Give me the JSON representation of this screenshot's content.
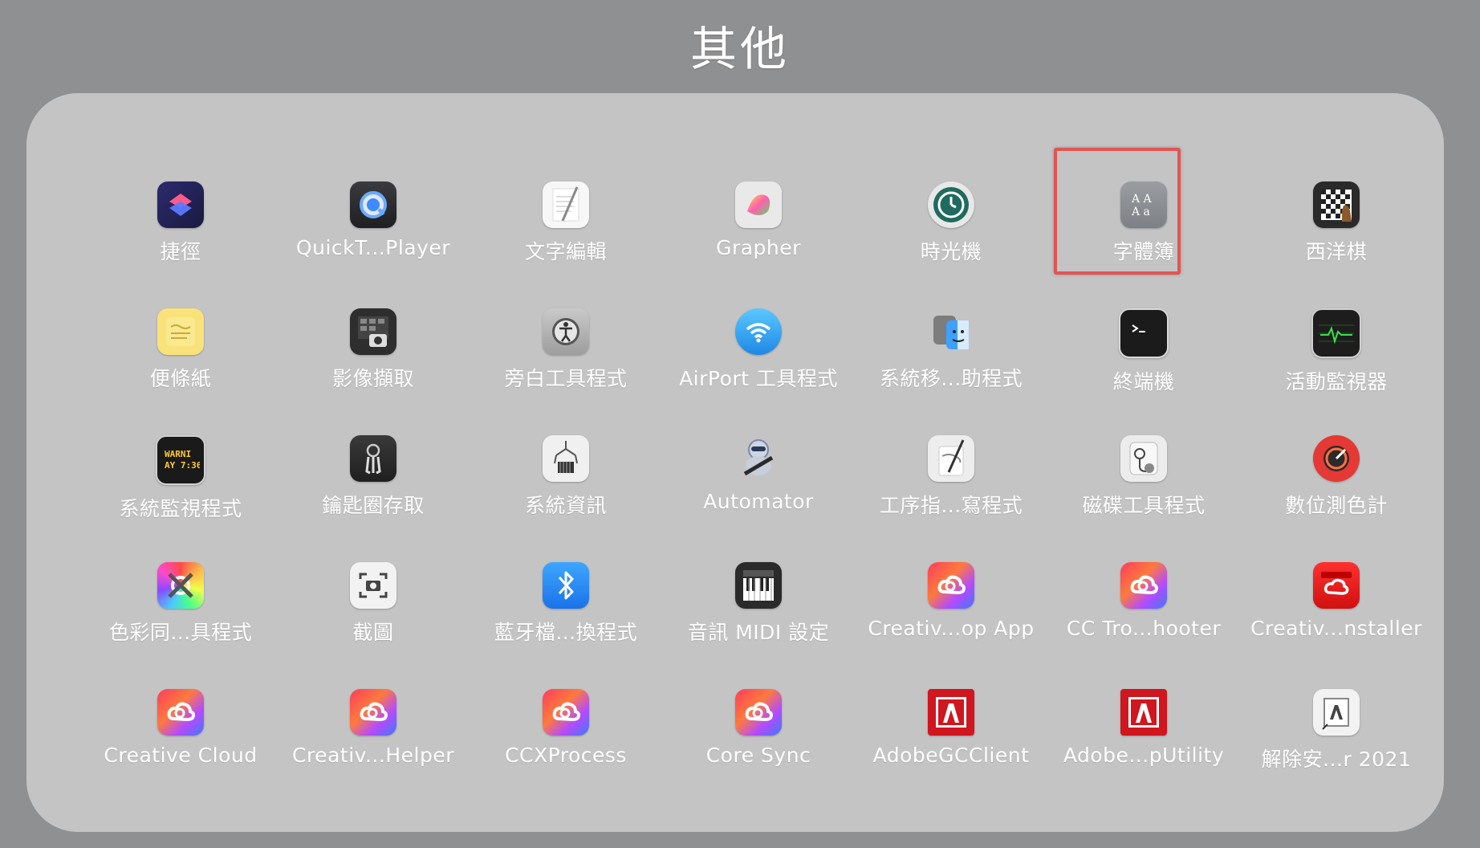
{
  "folder": {
    "title": "其他"
  },
  "highlight": {
    "app_index": 5,
    "color": "#e25552"
  },
  "apps": [
    {
      "label": "捷徑",
      "icon": "shortcuts-icon"
    },
    {
      "label": "QuickT...Player",
      "icon": "quicktime-icon"
    },
    {
      "label": "文字編輯",
      "icon": "textedit-icon"
    },
    {
      "label": "Grapher",
      "icon": "grapher-icon"
    },
    {
      "label": "時光機",
      "icon": "time-machine-icon"
    },
    {
      "label": "字體簿",
      "icon": "font-book-icon"
    },
    {
      "label": "西洋棋",
      "icon": "chess-icon"
    },
    {
      "label": "便條紙",
      "icon": "stickies-icon"
    },
    {
      "label": "影像擷取",
      "icon": "image-capture-icon"
    },
    {
      "label": "旁白工具程式",
      "icon": "voiceover-utility-icon"
    },
    {
      "label": "AirPort 工具程式",
      "icon": "airport-utility-icon"
    },
    {
      "label": "系統移...助程式",
      "icon": "migration-assistant-icon"
    },
    {
      "label": "終端機",
      "icon": "terminal-icon"
    },
    {
      "label": "活動監視器",
      "icon": "activity-monitor-icon"
    },
    {
      "label": "系統監視程式",
      "icon": "console-icon"
    },
    {
      "label": "鑰匙圈存取",
      "icon": "keychain-access-icon"
    },
    {
      "label": "系統資訊",
      "icon": "system-information-icon"
    },
    {
      "label": "Automator",
      "icon": "automator-icon"
    },
    {
      "label": "工序指...寫程式",
      "icon": "script-editor-icon"
    },
    {
      "label": "磁碟工具程式",
      "icon": "disk-utility-icon"
    },
    {
      "label": "數位測色計",
      "icon": "digital-color-meter-icon"
    },
    {
      "label": "色彩同...具程式",
      "icon": "colorsync-utility-icon"
    },
    {
      "label": "截圖",
      "icon": "screenshot-icon"
    },
    {
      "label": "藍牙檔...換程式",
      "icon": "bluetooth-file-exchange-icon"
    },
    {
      "label": "音訊 MIDI 設定",
      "icon": "audio-midi-setup-icon"
    },
    {
      "label": "Creativ...op App",
      "icon": "creative-cloud-desktop-icon"
    },
    {
      "label": "CC Tro...hooter",
      "icon": "cc-troubleshooter-icon"
    },
    {
      "label": "Creativ...nstaller",
      "icon": "creative-cloud-installer-icon"
    },
    {
      "label": "Creative Cloud",
      "icon": "creative-cloud-icon"
    },
    {
      "label": "Creativ...Helper",
      "icon": "creative-cloud-helper-icon"
    },
    {
      "label": "CCXProcess",
      "icon": "ccxprocess-icon"
    },
    {
      "label": "Core Sync",
      "icon": "core-sync-icon"
    },
    {
      "label": "AdobeGCClient",
      "icon": "adobe-gc-client-icon"
    },
    {
      "label": "Adobe...pUtility",
      "icon": "adobe-utility-icon"
    },
    {
      "label": "解除安...r 2021",
      "icon": "adobe-uninstaller-icon"
    }
  ]
}
